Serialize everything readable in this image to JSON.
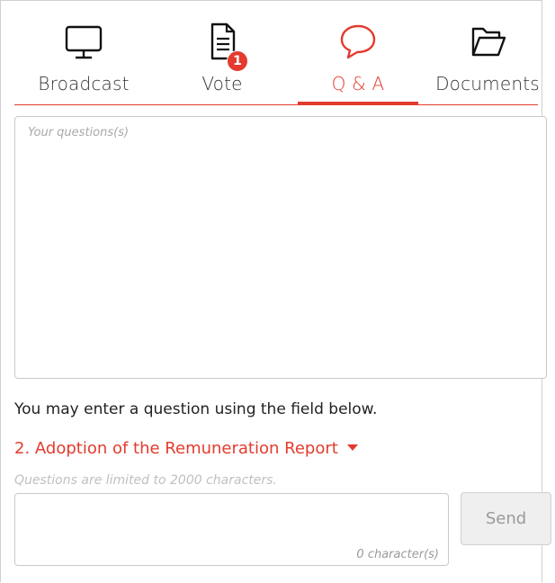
{
  "tabs": [
    {
      "label": "Broadcast",
      "icon": "monitor-icon",
      "active": false
    },
    {
      "label": "Vote",
      "icon": "document-icon",
      "active": false,
      "badge": "1"
    },
    {
      "label": "Q & A",
      "icon": "chat-bubble-icon",
      "active": true
    },
    {
      "label": "Documents",
      "icon": "folder-open-icon",
      "active": false
    }
  ],
  "questions_box": {
    "placeholder": "Your questions(s)"
  },
  "info_text": "You may enter a question using the field below.",
  "agenda_item": "2. Adoption of the Remuneration Report",
  "limit_note": "Questions are limited to 2000 characters.",
  "question_input": {
    "counter": "0 character(s)"
  },
  "send_label": "Send",
  "colors": {
    "accent": "#e33b2e",
    "text": "#333333",
    "muted": "#a9a9a9",
    "border": "#c9c9c9"
  }
}
